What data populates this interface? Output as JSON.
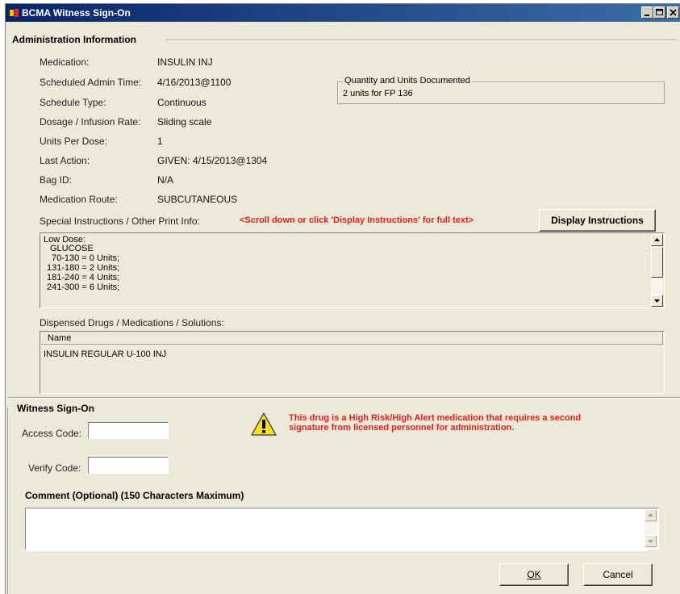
{
  "window": {
    "title": "BCMA Witness Sign-On",
    "controls": {
      "minimize": "_",
      "maximize": "□",
      "close": "X"
    }
  },
  "admin_info": {
    "section_title": "Administration Information",
    "fields": [
      {
        "label": "Medication:",
        "value": "INSULIN INJ"
      },
      {
        "label": "Scheduled Admin Time:",
        "value": "4/16/2013@1100"
      },
      {
        "label": "Schedule Type:",
        "value": "Continuous"
      },
      {
        "label": "Dosage / Infusion Rate:",
        "value": "Sliding scale"
      },
      {
        "label": "Units Per Dose:",
        "value": "1"
      },
      {
        "label": "Last Action:",
        "value": "GIVEN: 4/15/2013@1304"
      },
      {
        "label": "Bag ID:",
        "value": "N/A"
      },
      {
        "label": "Medication Route:",
        "value": "SUBCUTANEOUS"
      }
    ],
    "quantity": {
      "legend": "Quantity and Units Documented",
      "value": "2 units for FP 136"
    },
    "special_instructions": {
      "label": "Special Instructions / Other Print Info:",
      "hint": "<Scroll down or click 'Display Instructions' for full text>",
      "button": "Display Instructions",
      "lines": [
        "Low Dose:",
        "  GLUCOSE",
        "  70-130 = 0 Units;",
        " 131-180 = 2 Units;",
        " 181-240 = 4 Units;",
        " 241-300 = 6 Units;"
      ]
    },
    "dispensed": {
      "label": "Dispensed Drugs / Medications / Solutions:",
      "column_header": "Name",
      "rows": [
        "INSULIN REGULAR U-100 INJ"
      ]
    }
  },
  "witness": {
    "section_title": "Witness Sign-On",
    "access_label": "Access Code:",
    "access_value": "",
    "verify_label": "Verify Code:",
    "verify_value": "",
    "warning": "This drug is a High Risk/High Alert medication that requires a second signature from licensed personnel for administration.",
    "comment_label": "Comment (Optional)  (150 Characters Maximum)",
    "comment_value": ""
  },
  "buttons": {
    "ok": "OK",
    "cancel": "Cancel"
  },
  "colors": {
    "title_bar": "#0a246a",
    "warning_text": "#e0201e",
    "dialog_bg": "#ece9d8"
  }
}
